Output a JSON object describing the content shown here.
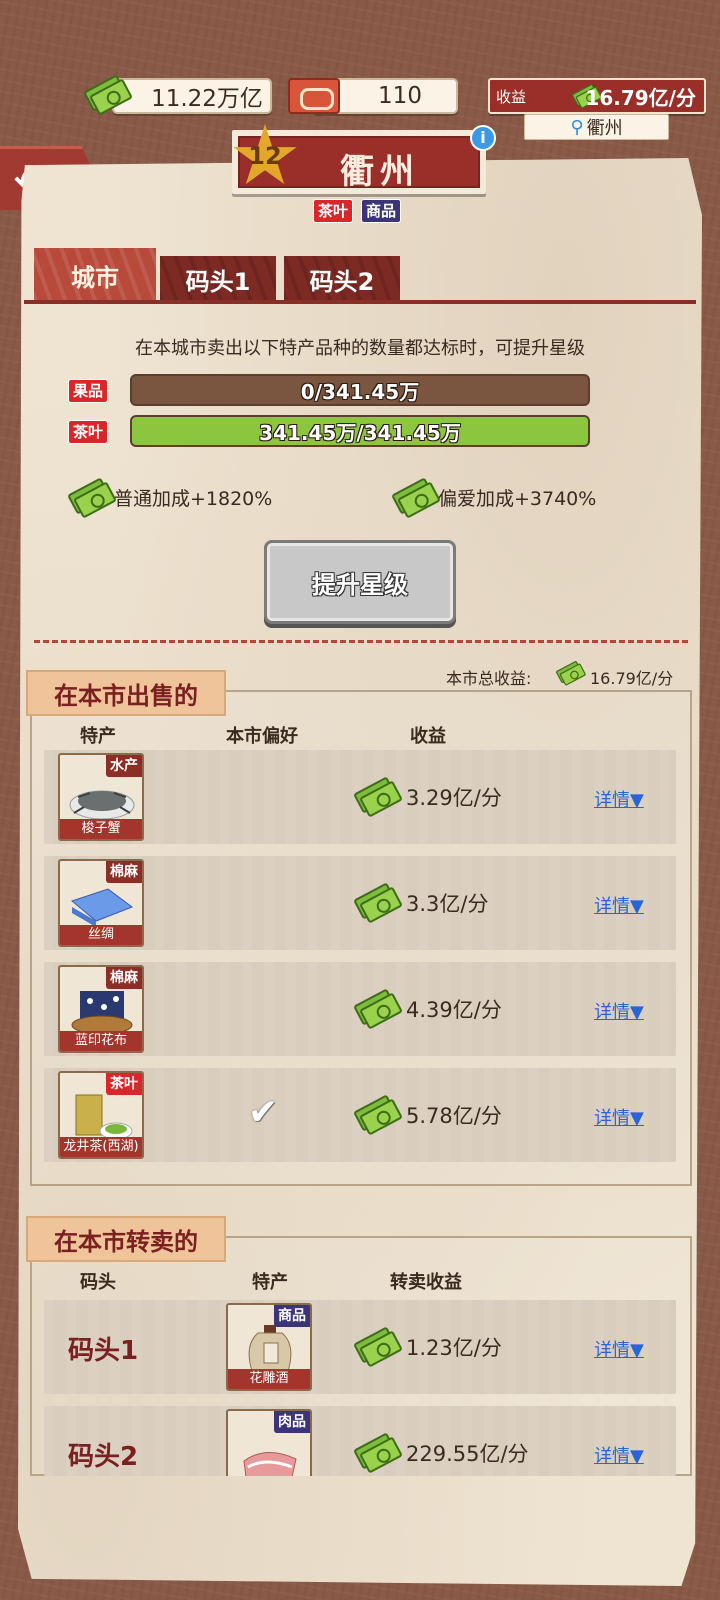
{
  "header": {
    "cash": "11.22万亿",
    "tickets": "110",
    "income_label": "收益",
    "income_value": "16.79亿/分",
    "location": "衢州"
  },
  "city": {
    "level": "12",
    "name": "衢州",
    "tags": [
      "茶叶",
      "商品"
    ]
  },
  "tabs": [
    "城市",
    "码头1",
    "码头2"
  ],
  "upgrade": {
    "requirement_text": "在本城市卖出以下特产品种的数量都达标时，可提升星级",
    "items": [
      {
        "tag": "果品",
        "progress_text": "0/341.45万",
        "progress": 0.0
      },
      {
        "tag": "茶叶",
        "progress_text": "341.45万/341.45万",
        "progress": 1.0
      }
    ],
    "normal_bonus": "普通加成+1820%",
    "favor_bonus": "偏爱加成+3740%",
    "button_label": "提升星级"
  },
  "selling": {
    "title": "在本市出售的",
    "total_label": "本市总收益:",
    "total_value": "16.79亿/分",
    "columns": [
      "特产",
      "本市偏好",
      "收益"
    ],
    "rows": [
      {
        "name": "梭子蟹",
        "category": "水产",
        "preferred": false,
        "income": "3.29亿/分",
        "detail": "详情▼"
      },
      {
        "name": "丝绸",
        "category": "棉麻",
        "preferred": false,
        "income": "3.3亿/分",
        "detail": "详情▼"
      },
      {
        "name": "蓝印花布",
        "category": "棉麻",
        "preferred": false,
        "income": "4.39亿/分",
        "detail": "详情▼"
      },
      {
        "name": "龙井茶(西湖)",
        "category": "茶叶",
        "preferred": true,
        "income": "5.78亿/分",
        "detail": "详情▼"
      }
    ]
  },
  "resale": {
    "title": "在本市转卖的",
    "columns": [
      "码头",
      "特产",
      "转卖收益"
    ],
    "rows": [
      {
        "dock": "码头1",
        "name": "花雕酒",
        "category": "商品",
        "income": "1.23亿/分",
        "detail": "详情▼"
      },
      {
        "dock": "码头2",
        "name": "",
        "category": "肉品",
        "income": "229.55亿/分",
        "detail": "详情▼"
      }
    ]
  }
}
